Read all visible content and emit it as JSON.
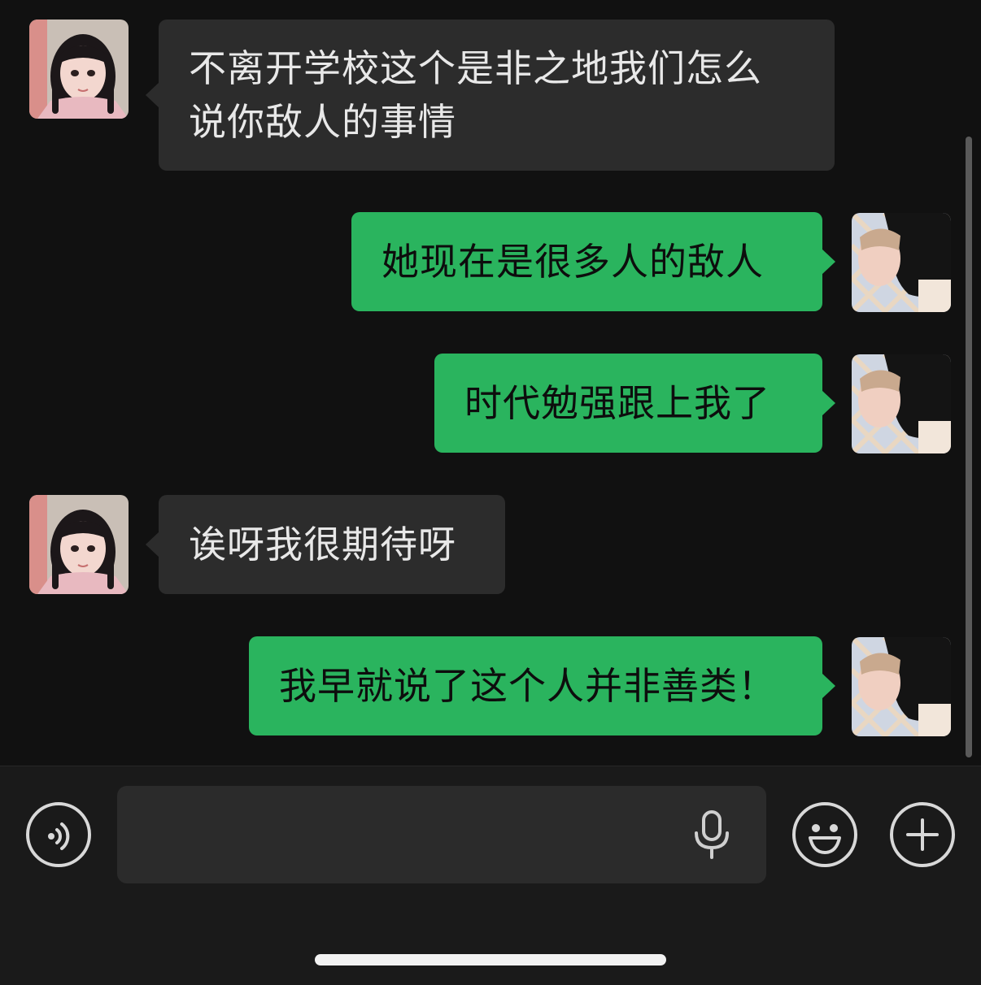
{
  "messages": [
    {
      "side": "incoming",
      "text": "不离开学校这个是非之地我们怎么\n说你敌人的事情",
      "avatar": "girl-avatar"
    },
    {
      "side": "outgoing",
      "text": "她现在是很多人的敌人",
      "avatar": "user-avatar"
    },
    {
      "side": "outgoing",
      "text": "时代勉强跟上我了",
      "avatar": "user-avatar"
    },
    {
      "side": "incoming",
      "text": "诶呀我很期待呀",
      "avatar": "girl-avatar"
    },
    {
      "side": "outgoing",
      "text": "我早就说了这个人并非善类！",
      "avatar": "user-avatar"
    }
  ],
  "input_bar": {
    "input_value": "",
    "icons": [
      "voice-icon",
      "microphone-icon",
      "emoji-icon",
      "plus-icon"
    ]
  },
  "colors": {
    "background": "#111111",
    "incoming_bubble": "#2c2c2c",
    "outgoing_bubble": "#2ab45e",
    "input_bar": "#1a1a1a"
  }
}
